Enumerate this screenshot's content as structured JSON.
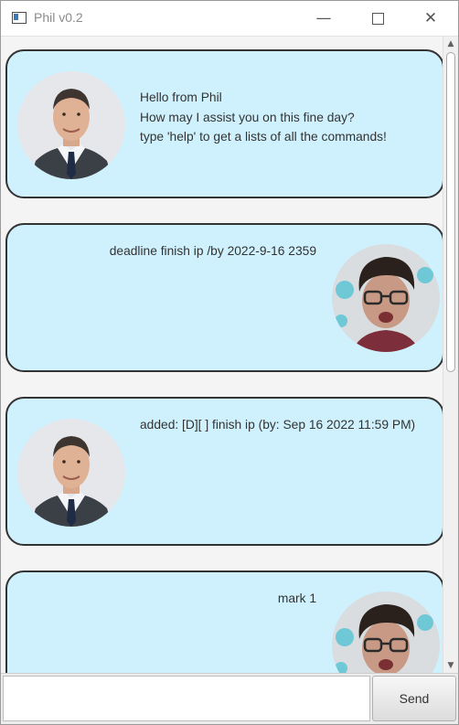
{
  "window": {
    "title": "Phil v0.2",
    "controls": {
      "minimize": "—",
      "close": "✕"
    }
  },
  "dialogs": [
    {
      "sender": "phil",
      "avatar": "phil-avatar",
      "text": "Hello from Phil\nHow may I assist you on this fine day?\ntype 'help' to get a lists of all the commands!"
    },
    {
      "sender": "user",
      "avatar": "user-avatar",
      "text": "deadline finish ip /by 2022-9-16 2359"
    },
    {
      "sender": "phil",
      "avatar": "phil-avatar",
      "text": "added: [D][ ] finish ip (by: Sep 16 2022 11:59 PM)"
    },
    {
      "sender": "user",
      "avatar": "user-avatar",
      "text": "mark 1"
    }
  ],
  "scrollbar": {
    "up_icon": "▲",
    "down_icon": "▼"
  },
  "input": {
    "value": "",
    "placeholder": ""
  },
  "send_button": {
    "label": "Send"
  },
  "colors": {
    "dialog_bg": "#cff1fd",
    "dialog_border": "#333333",
    "window_bg": "#f4f4f4"
  }
}
